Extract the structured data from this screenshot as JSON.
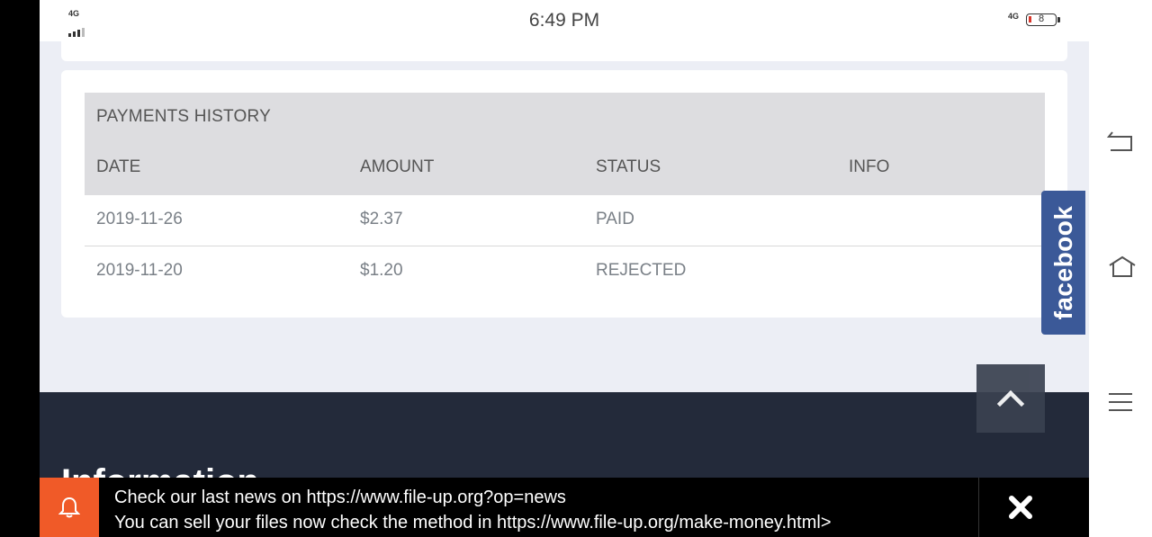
{
  "status_bar": {
    "time": "6:49 PM",
    "network_left": "4G",
    "network_right": "4G",
    "battery_level": "8"
  },
  "payments": {
    "title": "PAYMENTS HISTORY",
    "columns": [
      "DATE",
      "AMOUNT",
      "STATUS",
      "INFO"
    ],
    "rows": [
      {
        "date": "2019-11-26",
        "amount": "$2.37",
        "status": "PAID",
        "info": ""
      },
      {
        "date": "2019-11-20",
        "amount": "$1.20",
        "status": "REJECTED",
        "info": ""
      }
    ]
  },
  "facebook_tab": {
    "label": "facebook",
    "color": "#3b5998"
  },
  "footer": {
    "heading": "Information",
    "background": "#232a3a"
  },
  "notice": {
    "line1": "Check our last news on https://www.file-up.org?op=news",
    "line2": "You can sell your files now check the method in https://www.file-up.org/make-money.html>",
    "accent": "#f05a28"
  },
  "icons": {
    "back": "back-icon",
    "home": "home-icon",
    "menu": "menu-icon",
    "bell": "bell-icon",
    "close": "close-icon",
    "scroll_top": "chevron-up-icon"
  }
}
